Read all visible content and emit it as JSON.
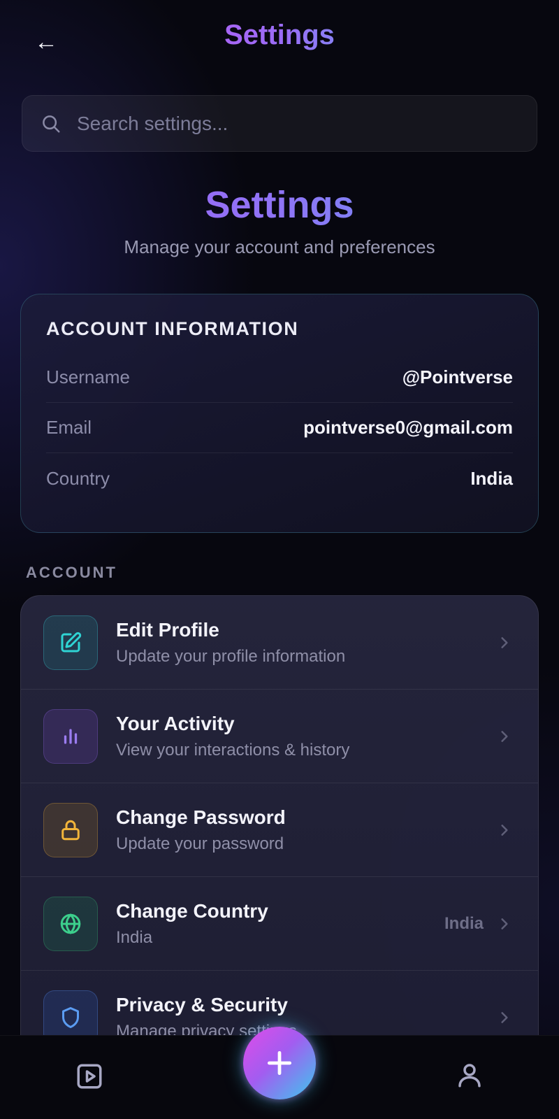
{
  "header": {
    "back_label": "←",
    "title": "Settings"
  },
  "search": {
    "placeholder": "Search settings..."
  },
  "hero": {
    "title": "Settings",
    "subtitle": "Manage your account and preferences"
  },
  "account_info": {
    "heading": "ACCOUNT INFORMATION",
    "rows": [
      {
        "label": "Username",
        "value": "@Pointverse"
      },
      {
        "label": "Email",
        "value": "pointverse0@gmail.com"
      },
      {
        "label": "Country",
        "value": "India"
      }
    ]
  },
  "section": {
    "heading": "ACCOUNT"
  },
  "items": [
    {
      "title": "Edit Profile",
      "subtitle": "Update your profile information",
      "icon": "edit-icon",
      "value": ""
    },
    {
      "title": "Your Activity",
      "subtitle": "View your interactions & history",
      "icon": "bar-chart-icon",
      "value": ""
    },
    {
      "title": "Change Password",
      "subtitle": "Update your password",
      "icon": "lock-icon",
      "value": ""
    },
    {
      "title": "Change Country",
      "subtitle": "India",
      "icon": "globe-icon",
      "value": "India"
    },
    {
      "title": "Privacy & Security",
      "subtitle": "Manage privacy settings",
      "icon": "shield-icon",
      "value": ""
    }
  ],
  "bottom_nav": {
    "left_icon": "play-icon",
    "center_icon": "plus-icon",
    "right_icon": "user-icon"
  },
  "colors": {
    "background": "#07070f",
    "accent_pink": "#d64bf0",
    "accent_cyan": "#3fd0ee",
    "teal": "#2fd4d4",
    "purple": "#9b7cf0",
    "amber": "#f2b53a",
    "green": "#3ccf8c",
    "blue": "#5b9cf2"
  }
}
